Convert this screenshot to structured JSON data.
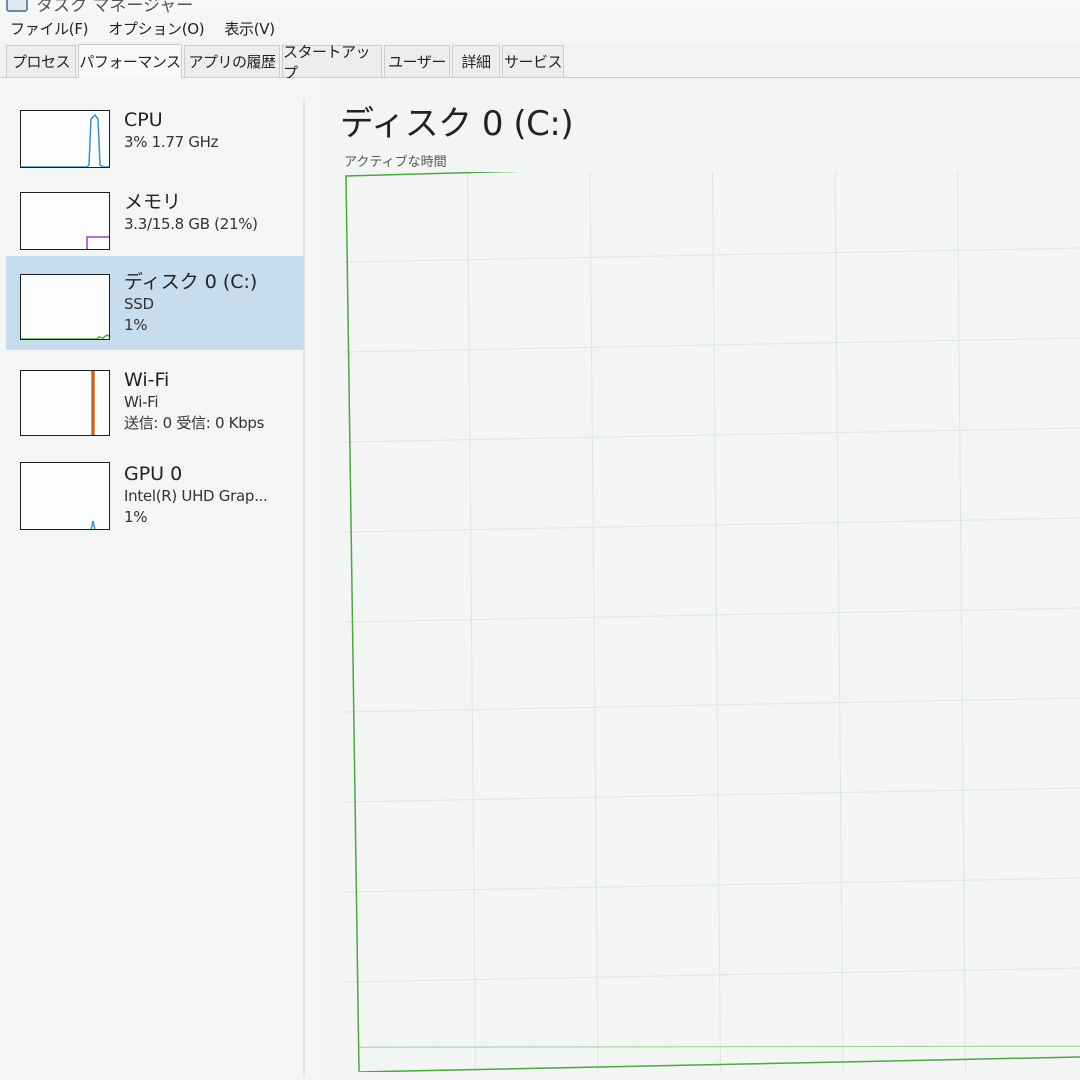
{
  "window": {
    "title": "タスク マネージャー"
  },
  "menu": [
    "ファイル(F)",
    "オプション(O)",
    "表示(V)"
  ],
  "tabs": [
    {
      "label": "プロセス",
      "active": false
    },
    {
      "label": "パフォーマンス",
      "active": true
    },
    {
      "label": "アプリの履歴",
      "active": false
    },
    {
      "label": "スタートアップ",
      "active": false
    },
    {
      "label": "ユーザー",
      "active": false
    },
    {
      "label": "詳細",
      "active": false
    },
    {
      "label": "サービス",
      "active": false
    }
  ],
  "sidebar": [
    {
      "name": "CPU",
      "line1": "3%  1.77 GHz",
      "line2": "",
      "color": "#3d92c4",
      "selected": false,
      "icon": "cpu-spike-icon"
    },
    {
      "name": "メモリ",
      "line1": "3.3/15.8 GB (21%)",
      "line2": "",
      "color": "#9b3fb5",
      "selected": false,
      "icon": "memory-level-icon"
    },
    {
      "name": "ディスク 0 (C:)",
      "line1": "SSD",
      "line2": "1%",
      "color": "#4ca642",
      "selected": true,
      "icon": "disk-activity-icon"
    },
    {
      "name": "Wi-Fi",
      "line1": "Wi-Fi",
      "line2": "送信: 0 受信: 0 Kbps",
      "color": "#b35a16",
      "selected": false,
      "icon": "network-spike-icon"
    },
    {
      "name": "GPU 0",
      "line1": "Intel(R) UHD Grap...",
      "line2": "1%",
      "color": "#3d92c4",
      "selected": false,
      "icon": "gpu-spike-icon"
    }
  ],
  "main": {
    "title": "ディスク 0 (C:)",
    "graph_caption": "アクティブな時間",
    "graph_color": "#4ca642",
    "grid_color": "#dde5dc",
    "active_time_percent": 1
  }
}
